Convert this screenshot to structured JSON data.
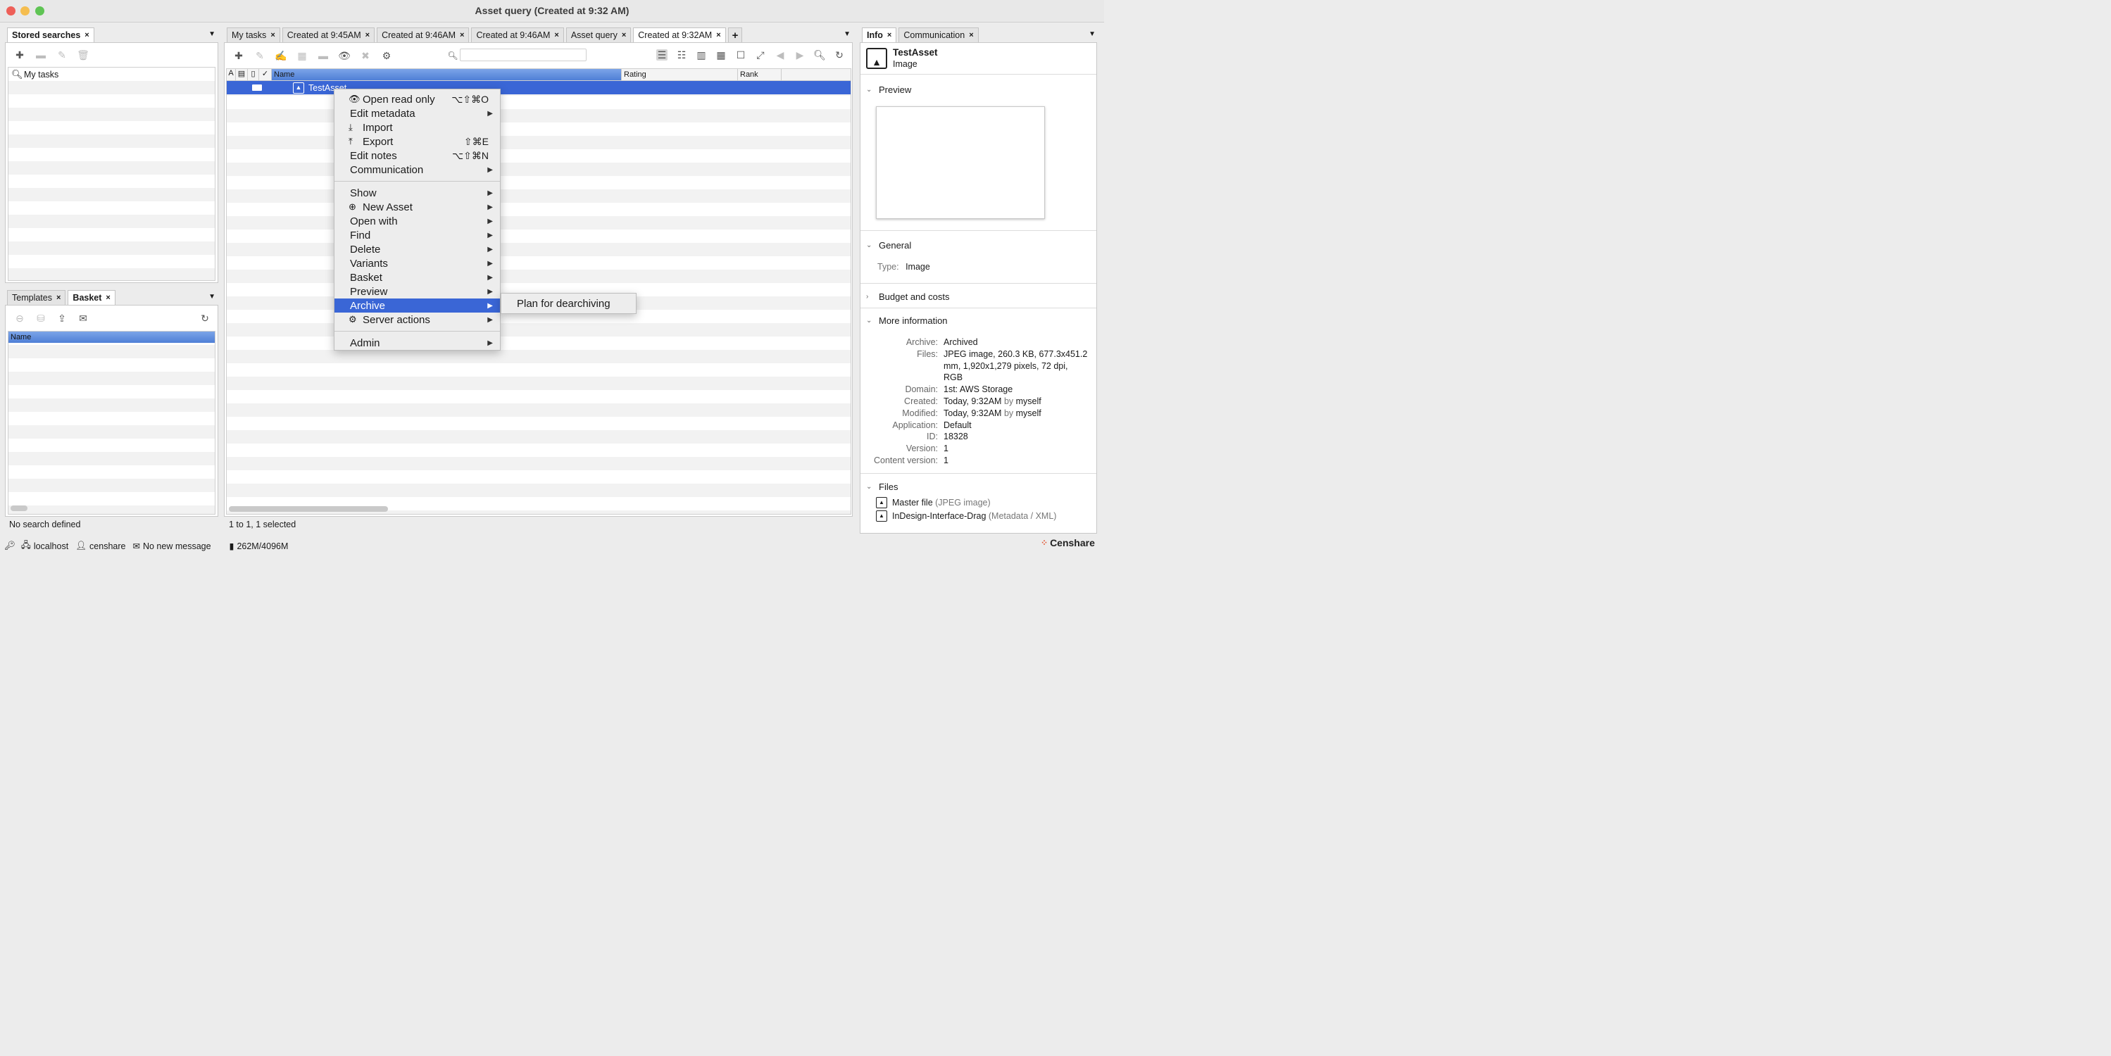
{
  "window": {
    "title": "Asset query (Created at 9:32 AM)"
  },
  "left_top": {
    "tab_label": "Stored searches",
    "close": "×",
    "items": [
      {
        "label": "My tasks"
      }
    ]
  },
  "left_bottom": {
    "tabs": [
      {
        "label": "Templates",
        "close": "×"
      },
      {
        "label": "Basket",
        "close": "×"
      }
    ],
    "column_header": "Name",
    "status": "No search defined"
  },
  "center": {
    "tabs": [
      {
        "label": "My tasks",
        "close": "×"
      },
      {
        "label": "Created at 9:45AM",
        "close": "×"
      },
      {
        "label": "Created at 9:46AM",
        "close": "×"
      },
      {
        "label": "Created at 9:46AM",
        "close": "×"
      },
      {
        "label": "Asset query",
        "close": "×"
      },
      {
        "label": "Created at 9:32AM",
        "close": "×"
      }
    ],
    "add_tab": "+",
    "search": {
      "placeholder": ""
    },
    "columns": {
      "name": "Name",
      "rating": "Rating",
      "rank": "Rank"
    },
    "selected_row": {
      "name": "TestAsset"
    },
    "status": "1 to 1, 1 selected"
  },
  "context_menu": {
    "group1": [
      {
        "label": "Open read only",
        "shortcut": "⌥⇧⌘O",
        "icon": "eye-icon"
      },
      {
        "label": "Edit metadata",
        "submenu": "▶"
      },
      {
        "label": "Import",
        "icon": "import-icon"
      },
      {
        "label": "Export",
        "shortcut": "⇧⌘E",
        "icon": "export-icon"
      },
      {
        "label": "Edit notes",
        "shortcut": "⌥⇧⌘N"
      },
      {
        "label": "Communication",
        "submenu": "▶"
      }
    ],
    "group2": [
      {
        "label": "Show",
        "submenu": "▶"
      },
      {
        "label": "New Asset",
        "submenu": "▶",
        "icon": "plus-circle-icon"
      },
      {
        "label": "Open with",
        "submenu": "▶"
      },
      {
        "label": "Find",
        "submenu": "▶"
      },
      {
        "label": "Delete",
        "submenu": "▶"
      },
      {
        "label": "Variants",
        "submenu": "▶"
      },
      {
        "label": "Basket",
        "submenu": "▶"
      },
      {
        "label": "Preview",
        "submenu": "▶"
      },
      {
        "label": "Archive",
        "submenu": "▶"
      },
      {
        "label": "Server actions",
        "submenu": "▶",
        "icon": "gear-icon"
      }
    ],
    "group3": [
      {
        "label": "Admin",
        "submenu": "▶"
      }
    ],
    "submenu_item": "Plan for dearchiving"
  },
  "right": {
    "tabs": [
      {
        "label": "Info",
        "close": "×"
      },
      {
        "label": "Communication",
        "close": "×"
      }
    ],
    "asset_name": "TestAsset",
    "asset_type": "Image",
    "sections": {
      "preview": "Preview",
      "general": "General",
      "budget": "Budget and costs",
      "more": "More information",
      "files": "Files"
    },
    "general": {
      "type_key": "Type:",
      "type_value": "Image"
    },
    "more_info": [
      {
        "k": "Archive:",
        "v": "Archived"
      },
      {
        "k": "Files:",
        "v": "JPEG image, 260.3 KB, 677.3x451.2 mm, 1,920x1,279 pixels, 72 dpi, RGB"
      },
      {
        "k": "Domain:",
        "v": "1st: AWS Storage"
      },
      {
        "k": "Created:",
        "v": "Today, 9:32AM",
        "by": "by",
        "who": "myself"
      },
      {
        "k": "Modified:",
        "v": "Today, 9:32AM",
        "by": "by",
        "who": "myself"
      },
      {
        "k": "Application:",
        "v": "Default"
      },
      {
        "k": "ID:",
        "v": "18328"
      },
      {
        "k": "Version:",
        "v": "1"
      },
      {
        "k": "Content version:",
        "v": "1"
      }
    ],
    "files": [
      {
        "name": "Master file",
        "type": "(JPEG image)"
      },
      {
        "name": "InDesign-Interface-Drag",
        "type": "(Metadata / XML)"
      }
    ]
  },
  "statusbar": {
    "host": "localhost",
    "user": "censhare",
    "messages": "No new message",
    "memory": "262M/4096M",
    "brand": "Censhare"
  }
}
